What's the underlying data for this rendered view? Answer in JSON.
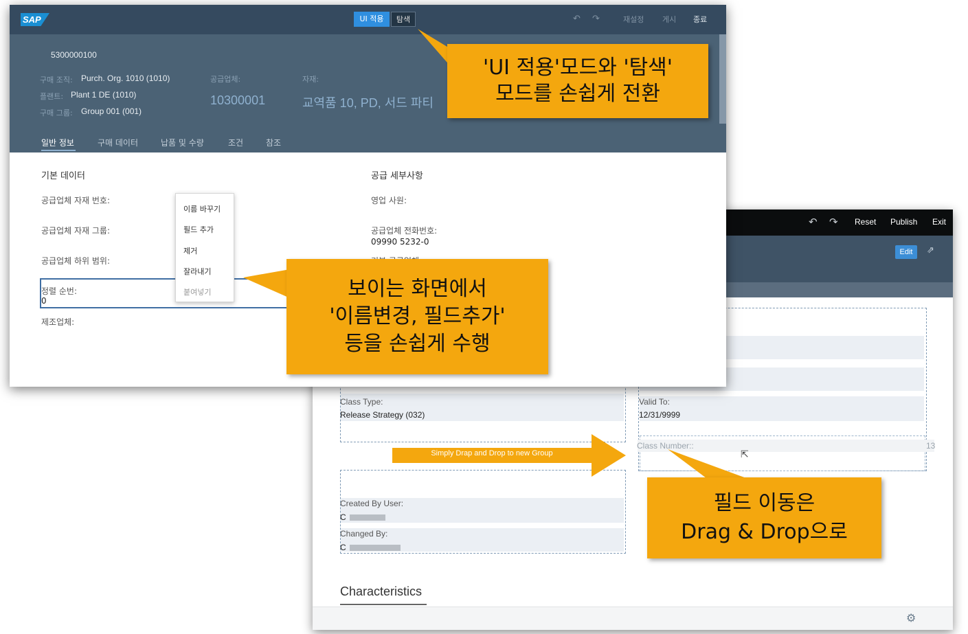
{
  "back_screen": {
    "shell": {
      "undo_icon": "undo-icon",
      "redo_icon": "redo-icon",
      "reset": "Reset",
      "publish": "Publish",
      "exit": "Exit"
    },
    "header": {
      "edit_button": "Edit",
      "share_icon": "share-icon"
    },
    "fields": {
      "class_type_label": "Class Type:",
      "class_type_value": "Release Strategy (032)",
      "valid_to_label": "Valid To:",
      "valid_to_value": "12/31/9999",
      "class_number_label": "Class Number::",
      "class_number_value": "13",
      "created_by_label": "Created By User:",
      "created_by_value": "C",
      "changed_by_label": "Changed By:",
      "changed_by_value": "C"
    },
    "drag_arrow_text": "Simply Drap and Drop to new Group",
    "section_title": "Characteristics",
    "footer_icon": "settings-icon"
  },
  "front_screen": {
    "shell": {
      "logo": "SAP",
      "mode_ui_adapt": "UI 적용",
      "mode_navigate": "탐색",
      "undo_icon": "undo-icon",
      "redo_icon": "redo-icon",
      "reset": "재설정",
      "publish": "게시",
      "exit": "종료"
    },
    "header": {
      "object_id": "5300000100",
      "purch_org_label": "구매 조직:",
      "purch_org_value": "Purch. Org. 1010 (1010)",
      "plant_label": "플랜트:",
      "plant_value": "Plant 1 DE (1010)",
      "group_label": "구매 그룹:",
      "group_value": "Group 001 (001)",
      "supplier_label": "공급업체:",
      "supplier_value": "10300001",
      "material_label": "자재:",
      "material_value": "교역품 10, PD, 서드 파티"
    },
    "tabs": [
      "일반 정보",
      "구매 데이터",
      "납품 및 수량",
      "조건",
      "참조"
    ],
    "sections": {
      "basic_data_title": "기본 데이터",
      "supply_details_title": "공급 세부사항"
    },
    "fields": {
      "supplier_material_no": "공급업체 자재 번호:",
      "supplier_material_group": "공급업체 자재 그룹:",
      "supplier_subrange": "공급업체 하위 범위:",
      "sort_number": "정렬 순번:",
      "sort_number_value": "0",
      "manufacturer": "제조업체:",
      "sales_person": "영업 사원:",
      "supplier_phone_label": "공급업체 전화번호:",
      "supplier_phone_value": "09990 5232-0",
      "default_supplier": "기본 공급업체:"
    },
    "context_menu": [
      "이름 바꾸기",
      "필드 추가",
      "제거",
      "잘라내기",
      "붙여넣기"
    ]
  },
  "callouts": {
    "mode_switch": [
      "'UI 적용'모드와 '탐색'",
      "모드를 손쉽게 전환"
    ],
    "rename_add": [
      "보이는 화면에서",
      "'이름변경, 필드추가'",
      "등을 손쉽게 수행"
    ],
    "drag_drop": [
      "필드 이동은",
      "Drag & Drop으로"
    ]
  },
  "colors": {
    "callout": "#f4a70e",
    "shell_dark": "#354a5f",
    "header_bg": "#4b6275",
    "accent_blue": "#3c8ed6"
  }
}
